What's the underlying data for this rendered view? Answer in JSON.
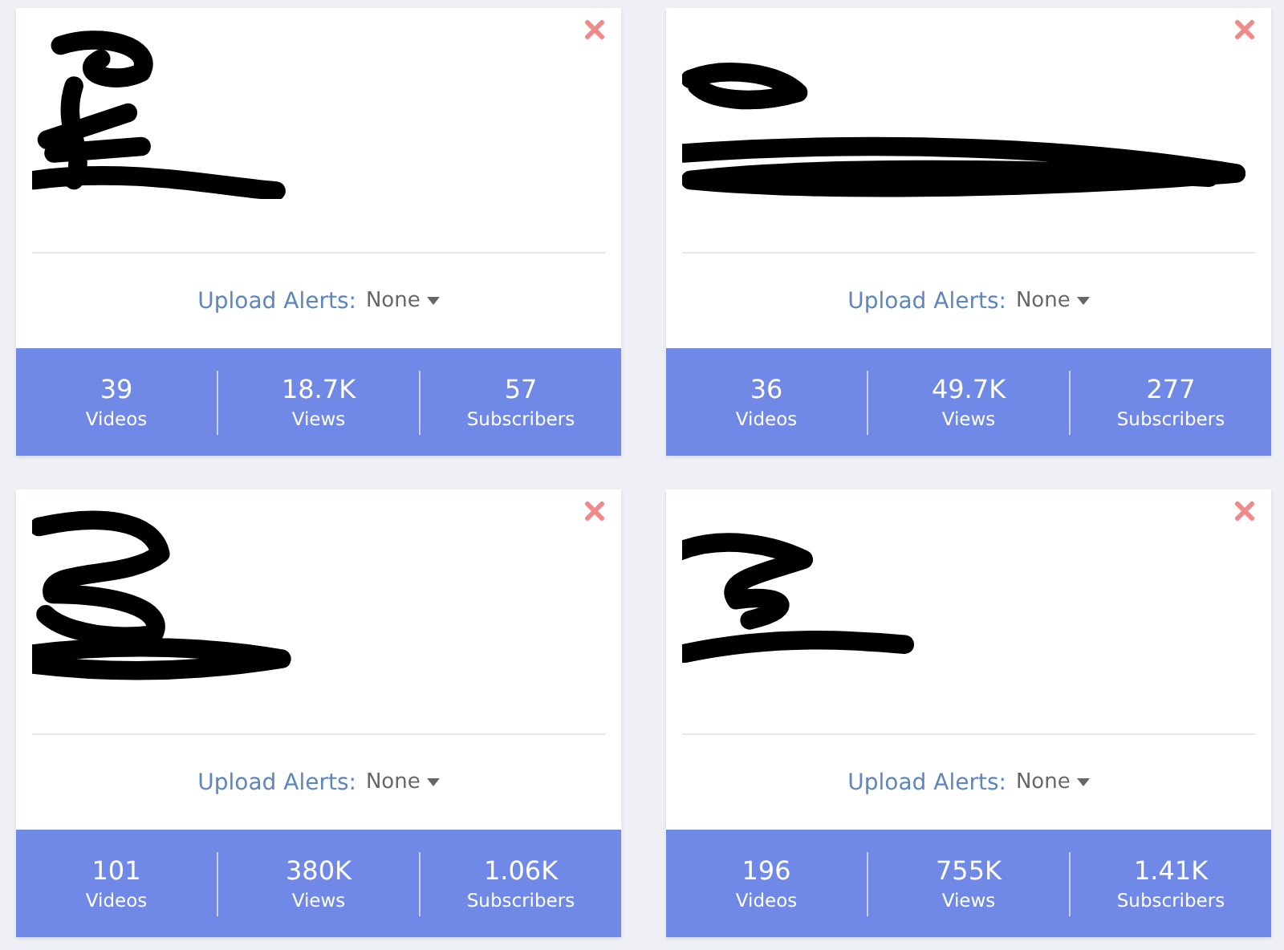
{
  "cards": [
    {
      "alerts_label": "Upload Alerts:",
      "alerts_value": "None",
      "stats": [
        {
          "value": "39",
          "label": "Videos"
        },
        {
          "value": "18.7K",
          "label": "Views"
        },
        {
          "value": "57",
          "label": "Subscribers"
        }
      ]
    },
    {
      "alerts_label": "Upload Alerts:",
      "alerts_value": "None",
      "stats": [
        {
          "value": "36",
          "label": "Videos"
        },
        {
          "value": "49.7K",
          "label": "Views"
        },
        {
          "value": "277",
          "label": "Subscribers"
        }
      ]
    },
    {
      "alerts_label": "Upload Alerts:",
      "alerts_value": "None",
      "stats": [
        {
          "value": "101",
          "label": "Videos"
        },
        {
          "value": "380K",
          "label": "Views"
        },
        {
          "value": "1.06K",
          "label": "Subscribers"
        }
      ]
    },
    {
      "alerts_label": "Upload Alerts:",
      "alerts_value": "None",
      "stats": [
        {
          "value": "196",
          "label": "Videos"
        },
        {
          "value": "755K",
          "label": "Views"
        },
        {
          "value": "1.41K",
          "label": "Subscribers"
        }
      ]
    }
  ]
}
